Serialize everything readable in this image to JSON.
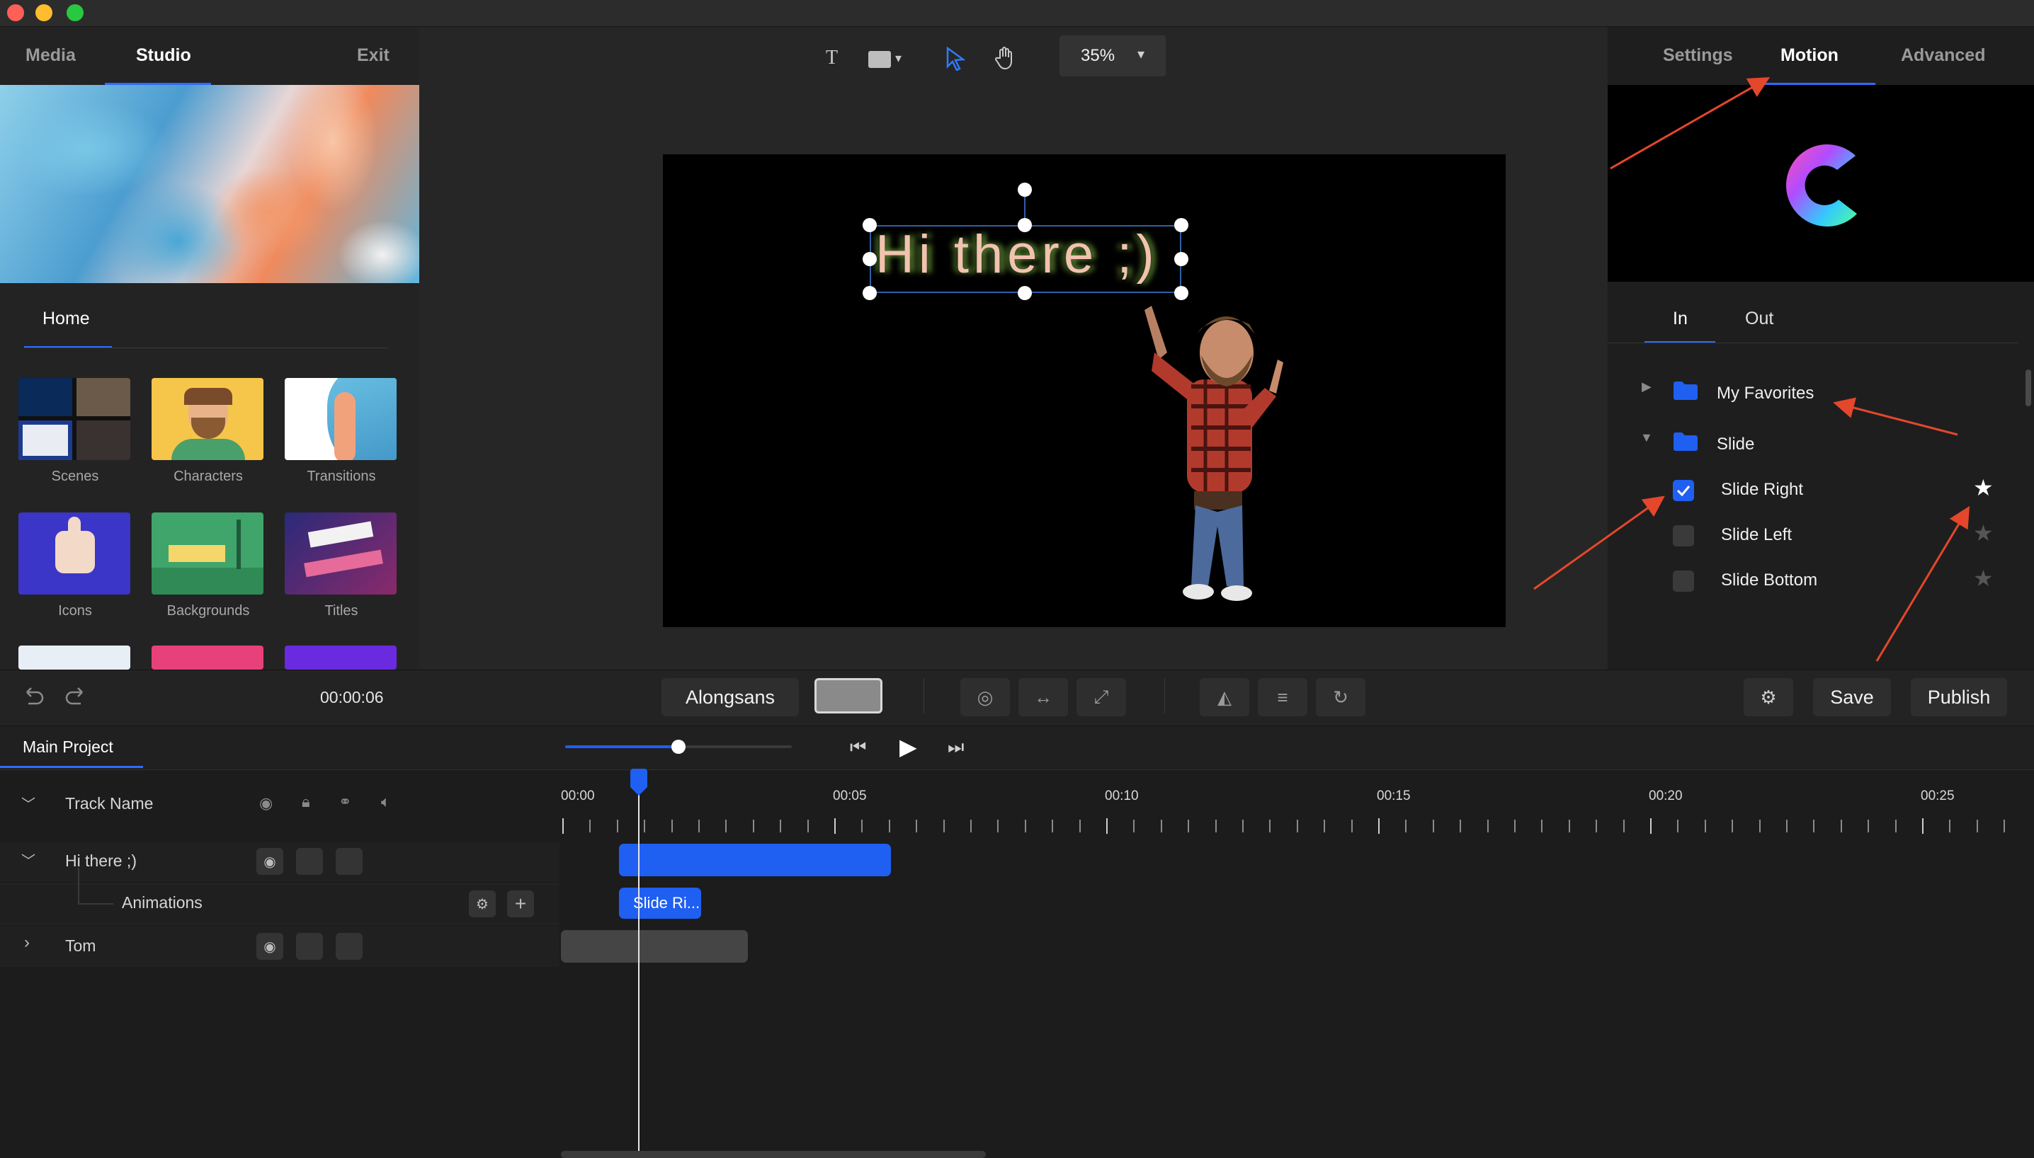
{
  "left_panel": {
    "tabs": [
      "Media",
      "Studio"
    ],
    "exit_label": "Exit",
    "home_label": "Home",
    "library": [
      "Scenes",
      "Characters",
      "Transitions",
      "Icons",
      "Backgrounds",
      "Titles"
    ]
  },
  "canvas": {
    "zoom": "35%",
    "text_layer": "Hi there ;)"
  },
  "right_panel": {
    "tabs": [
      "Settings",
      "Motion",
      "Advanced"
    ],
    "sub_tabs": [
      "In",
      "Out"
    ],
    "folders": [
      "My Favorites",
      "Slide"
    ],
    "animations": [
      {
        "label": "Slide Right",
        "checked": true,
        "favorite": true
      },
      {
        "label": "Slide Left",
        "checked": false,
        "favorite": false
      },
      {
        "label": "Slide Bottom",
        "checked": false,
        "favorite": false
      }
    ]
  },
  "toolbar": {
    "time": "00:00:06",
    "font": "Alongsans",
    "save_label": "Save",
    "publish_label": "Publish"
  },
  "timeline": {
    "project_tab": "Main Project",
    "header_label": "Track Name",
    "tracks": [
      "Hi there ;)",
      "Animations",
      "Tom"
    ],
    "clip_label": "Slide Ri...",
    "ruler": [
      "00:00",
      "00:05",
      "00:10",
      "00:15",
      "00:20",
      "00:25"
    ],
    "playhead_seconds": 1.4,
    "scrubber_fraction": 0.5
  },
  "colors": {
    "accent": "#1f5ff2",
    "arrow": "#e4472c"
  }
}
